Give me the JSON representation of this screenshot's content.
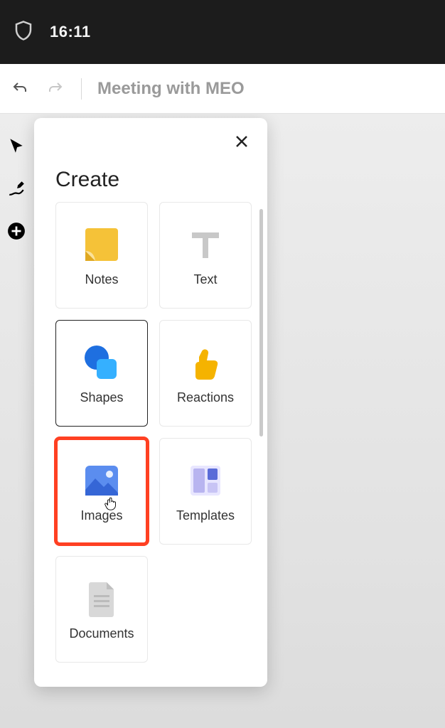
{
  "statusBar": {
    "time": "16:11"
  },
  "toolbar": {
    "title": "Meeting with MEO"
  },
  "createPanel": {
    "title": "Create",
    "items": {
      "notes": "Notes",
      "text": "Text",
      "shapes": "Shapes",
      "reactions": "Reactions",
      "images": "Images",
      "templates": "Templates",
      "documents": "Documents"
    }
  }
}
